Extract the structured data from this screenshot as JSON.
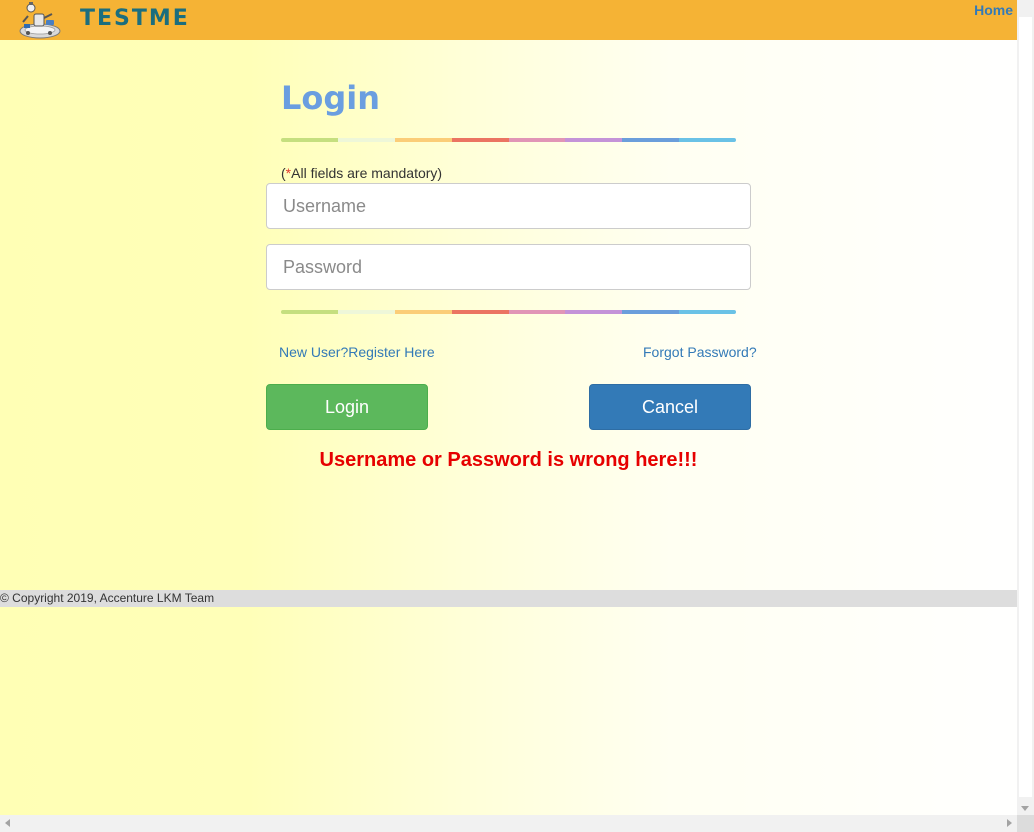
{
  "header": {
    "logo_text": "TESTME",
    "home_link": "Home",
    "logo_icon": "robot-rider-icon"
  },
  "login": {
    "title": "Login",
    "mandatory_prefix": "(",
    "mandatory_star": "*",
    "mandatory_text": "All fields are mandatory)",
    "username_placeholder": "Username",
    "username_value": "",
    "password_placeholder": "Password",
    "password_value": "",
    "register_link": "New User?Register Here",
    "forgot_link": "Forgot Password?",
    "login_button": "Login",
    "cancel_button": "Cancel",
    "error_message": "Username or Password is wrong here!!!",
    "rainbow_colors": [
      "#c5df7f",
      "#eef7d9",
      "#fbcd78",
      "#eb7462",
      "#e195b6",
      "#c493d8",
      "#6b9edb",
      "#6ac2e6"
    ]
  },
  "footer": {
    "copyright": "© Copyright 2019, Accenture LKM Team"
  },
  "colors": {
    "header_bg": "#f5b335",
    "login_button": "#5cb85c",
    "cancel_button": "#337ab7",
    "error": "#e60000",
    "title": "#6a9ee0"
  }
}
